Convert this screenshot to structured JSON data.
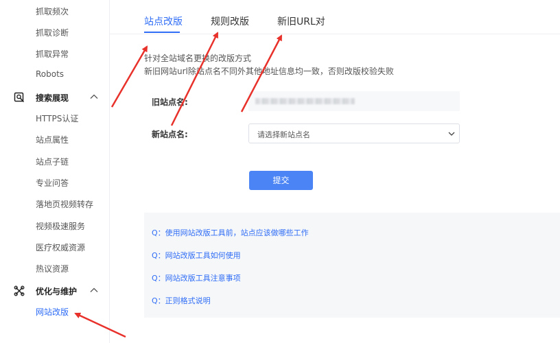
{
  "sidebar": {
    "items_top": [
      "抓取频次",
      "抓取诊断",
      "抓取异常",
      "Robots"
    ],
    "group_search": {
      "label": "搜索展现",
      "icon": "search-doc-icon"
    },
    "items_search": [
      "HTTPS认证",
      "站点属性",
      "站点子链",
      "专业问答",
      "落地页视频转存",
      "视频极速服务",
      "医疗权威资源",
      "热议资源"
    ],
    "group_optimize": {
      "label": "优化与维护",
      "icon": "tools-icon"
    },
    "items_optimize": [
      "网站改版"
    ]
  },
  "tabs": [
    "站点改版",
    "规则改版",
    "新旧URL对"
  ],
  "description": {
    "line1": "针对全站域名更换的改版方式",
    "line2": "新旧网站url除站点名不同外其他地址信息均一致，否则改版校验失败"
  },
  "form": {
    "old_label": "旧站点名:",
    "new_label": "新站点名:",
    "new_select_value": "请选择新站点名",
    "submit_label": "提交"
  },
  "faq": [
    "Q：使用网站改版工具前，站点应该做哪些工作",
    "Q：网站改版工具如何使用",
    "Q：网站改版工具注意事项",
    "Q：正则格式说明"
  ],
  "colors": {
    "accent": "#2f6df6",
    "arrow": "#e8312a",
    "button": "#4a84f5"
  }
}
